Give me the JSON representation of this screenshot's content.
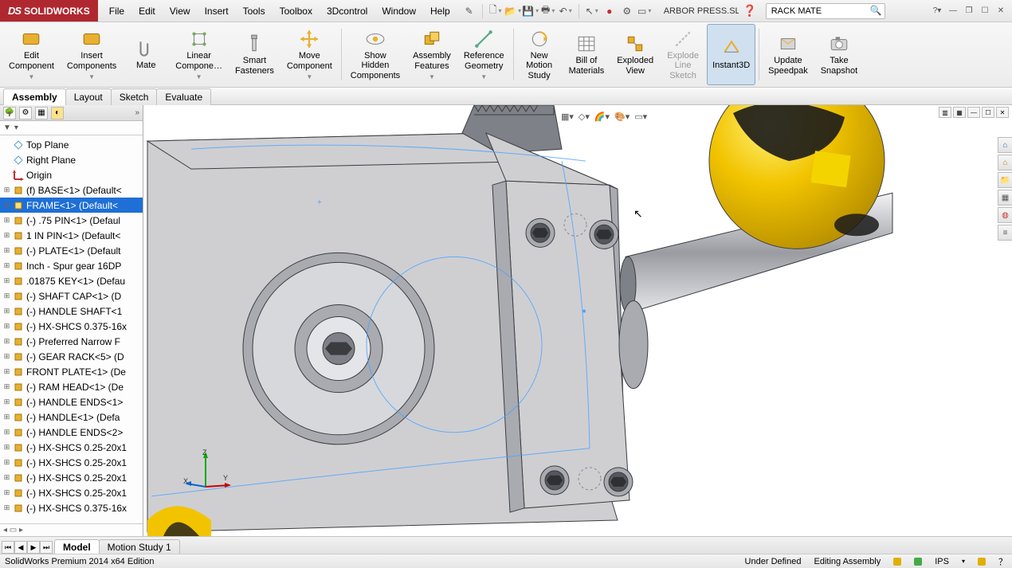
{
  "app": {
    "brand_prefix": "DS",
    "brand_name": "SOLIDWORKS"
  },
  "menu": [
    "File",
    "Edit",
    "View",
    "Insert",
    "Tools",
    "Toolbox",
    "3Dcontrol",
    "Window",
    "Help"
  ],
  "title_tools": {
    "document_name": "ARBOR PRESS.SLD…",
    "search_value": "RACK MATE"
  },
  "ribbon": [
    {
      "id": "edit-component",
      "label": "Edit\nComponent",
      "dd": true
    },
    {
      "id": "insert-components",
      "label": "Insert\nComponents",
      "dd": true
    },
    {
      "id": "mate",
      "label": "Mate"
    },
    {
      "id": "linear-component-pattern",
      "label": "Linear\nCompone…",
      "dd": true
    },
    {
      "id": "smart-fasteners",
      "label": "Smart\nFasteners"
    },
    {
      "id": "move-component",
      "label": "Move\nComponent",
      "dd": true
    },
    {
      "sep": true
    },
    {
      "id": "show-hidden-components",
      "label": "Show\nHidden\nComponents"
    },
    {
      "id": "assembly-features",
      "label": "Assembly\nFeatures",
      "dd": true
    },
    {
      "id": "reference-geometry",
      "label": "Reference\nGeometry",
      "dd": true
    },
    {
      "sep": true
    },
    {
      "id": "new-motion-study",
      "label": "New\nMotion\nStudy"
    },
    {
      "id": "bill-of-materials",
      "label": "Bill of\nMaterials"
    },
    {
      "id": "exploded-view",
      "label": "Exploded\nView"
    },
    {
      "id": "explode-line-sketch",
      "label": "Explode\nLine\nSketch",
      "disabled": true
    },
    {
      "id": "instant3d",
      "label": "Instant3D",
      "active": true
    },
    {
      "sep": true
    },
    {
      "id": "update-speedpak",
      "label": "Update\nSpeedpak"
    },
    {
      "id": "take-snapshot",
      "label": "Take\nSnapshot"
    }
  ],
  "tabs": [
    "Assembly",
    "Layout",
    "Sketch",
    "Evaluate"
  ],
  "active_tab": "Assembly",
  "tree": [
    {
      "exp": "",
      "icon": "plane",
      "label": "Top Plane"
    },
    {
      "exp": "",
      "icon": "plane",
      "label": "Right Plane"
    },
    {
      "exp": "",
      "icon": "origin",
      "label": "Origin"
    },
    {
      "exp": "+",
      "icon": "part",
      "label": "(f) BASE<1> (Default<"
    },
    {
      "exp": "+",
      "icon": "part",
      "label": "FRAME<1> (Default<",
      "selected": true
    },
    {
      "exp": "+",
      "icon": "part",
      "label": "(-) .75 PIN<1> (Defaul"
    },
    {
      "exp": "+",
      "icon": "part",
      "label": "1 IN PIN<1> (Default<"
    },
    {
      "exp": "+",
      "icon": "part",
      "label": "(-) PLATE<1> (Default"
    },
    {
      "exp": "+",
      "icon": "part",
      "label": "Inch - Spur gear 16DP"
    },
    {
      "exp": "+",
      "icon": "part",
      "label": ".01875 KEY<1> (Defau"
    },
    {
      "exp": "+",
      "icon": "part",
      "label": "(-) SHAFT CAP<1> (D"
    },
    {
      "exp": "+",
      "icon": "part",
      "label": "(-) HANDLE SHAFT<1"
    },
    {
      "exp": "+",
      "icon": "part",
      "label": "(-) HX-SHCS 0.375-16x"
    },
    {
      "exp": "+",
      "icon": "part",
      "label": "(-) Preferred Narrow F"
    },
    {
      "exp": "+",
      "icon": "part",
      "label": "(-) GEAR RACK<5> (D"
    },
    {
      "exp": "+",
      "icon": "part",
      "label": "FRONT PLATE<1> (De"
    },
    {
      "exp": "+",
      "icon": "part",
      "label": "(-) RAM HEAD<1> (De"
    },
    {
      "exp": "+",
      "icon": "part",
      "label": "(-) HANDLE ENDS<1>"
    },
    {
      "exp": "+",
      "icon": "part",
      "label": "(-) HANDLE<1> (Defa"
    },
    {
      "exp": "+",
      "icon": "part",
      "label": "(-) HANDLE ENDS<2>"
    },
    {
      "exp": "+",
      "icon": "part",
      "label": "(-) HX-SHCS 0.25-20x1"
    },
    {
      "exp": "+",
      "icon": "part",
      "label": "(-) HX-SHCS 0.25-20x1"
    },
    {
      "exp": "+",
      "icon": "part",
      "label": "(-) HX-SHCS 0.25-20x1"
    },
    {
      "exp": "+",
      "icon": "part",
      "label": "(-) HX-SHCS 0.25-20x1"
    },
    {
      "exp": "+",
      "icon": "part",
      "label": "(-) HX-SHCS 0.375-16x"
    }
  ],
  "triad": {
    "x": "X",
    "y": "Y",
    "z": "Z"
  },
  "bottom_tabs": {
    "active": "Model",
    "other": "Motion Study 1"
  },
  "status": {
    "edition": "SolidWorks Premium 2014 x64 Edition",
    "define": "Under Defined",
    "mode": "Editing Assembly",
    "units": "IPS"
  }
}
